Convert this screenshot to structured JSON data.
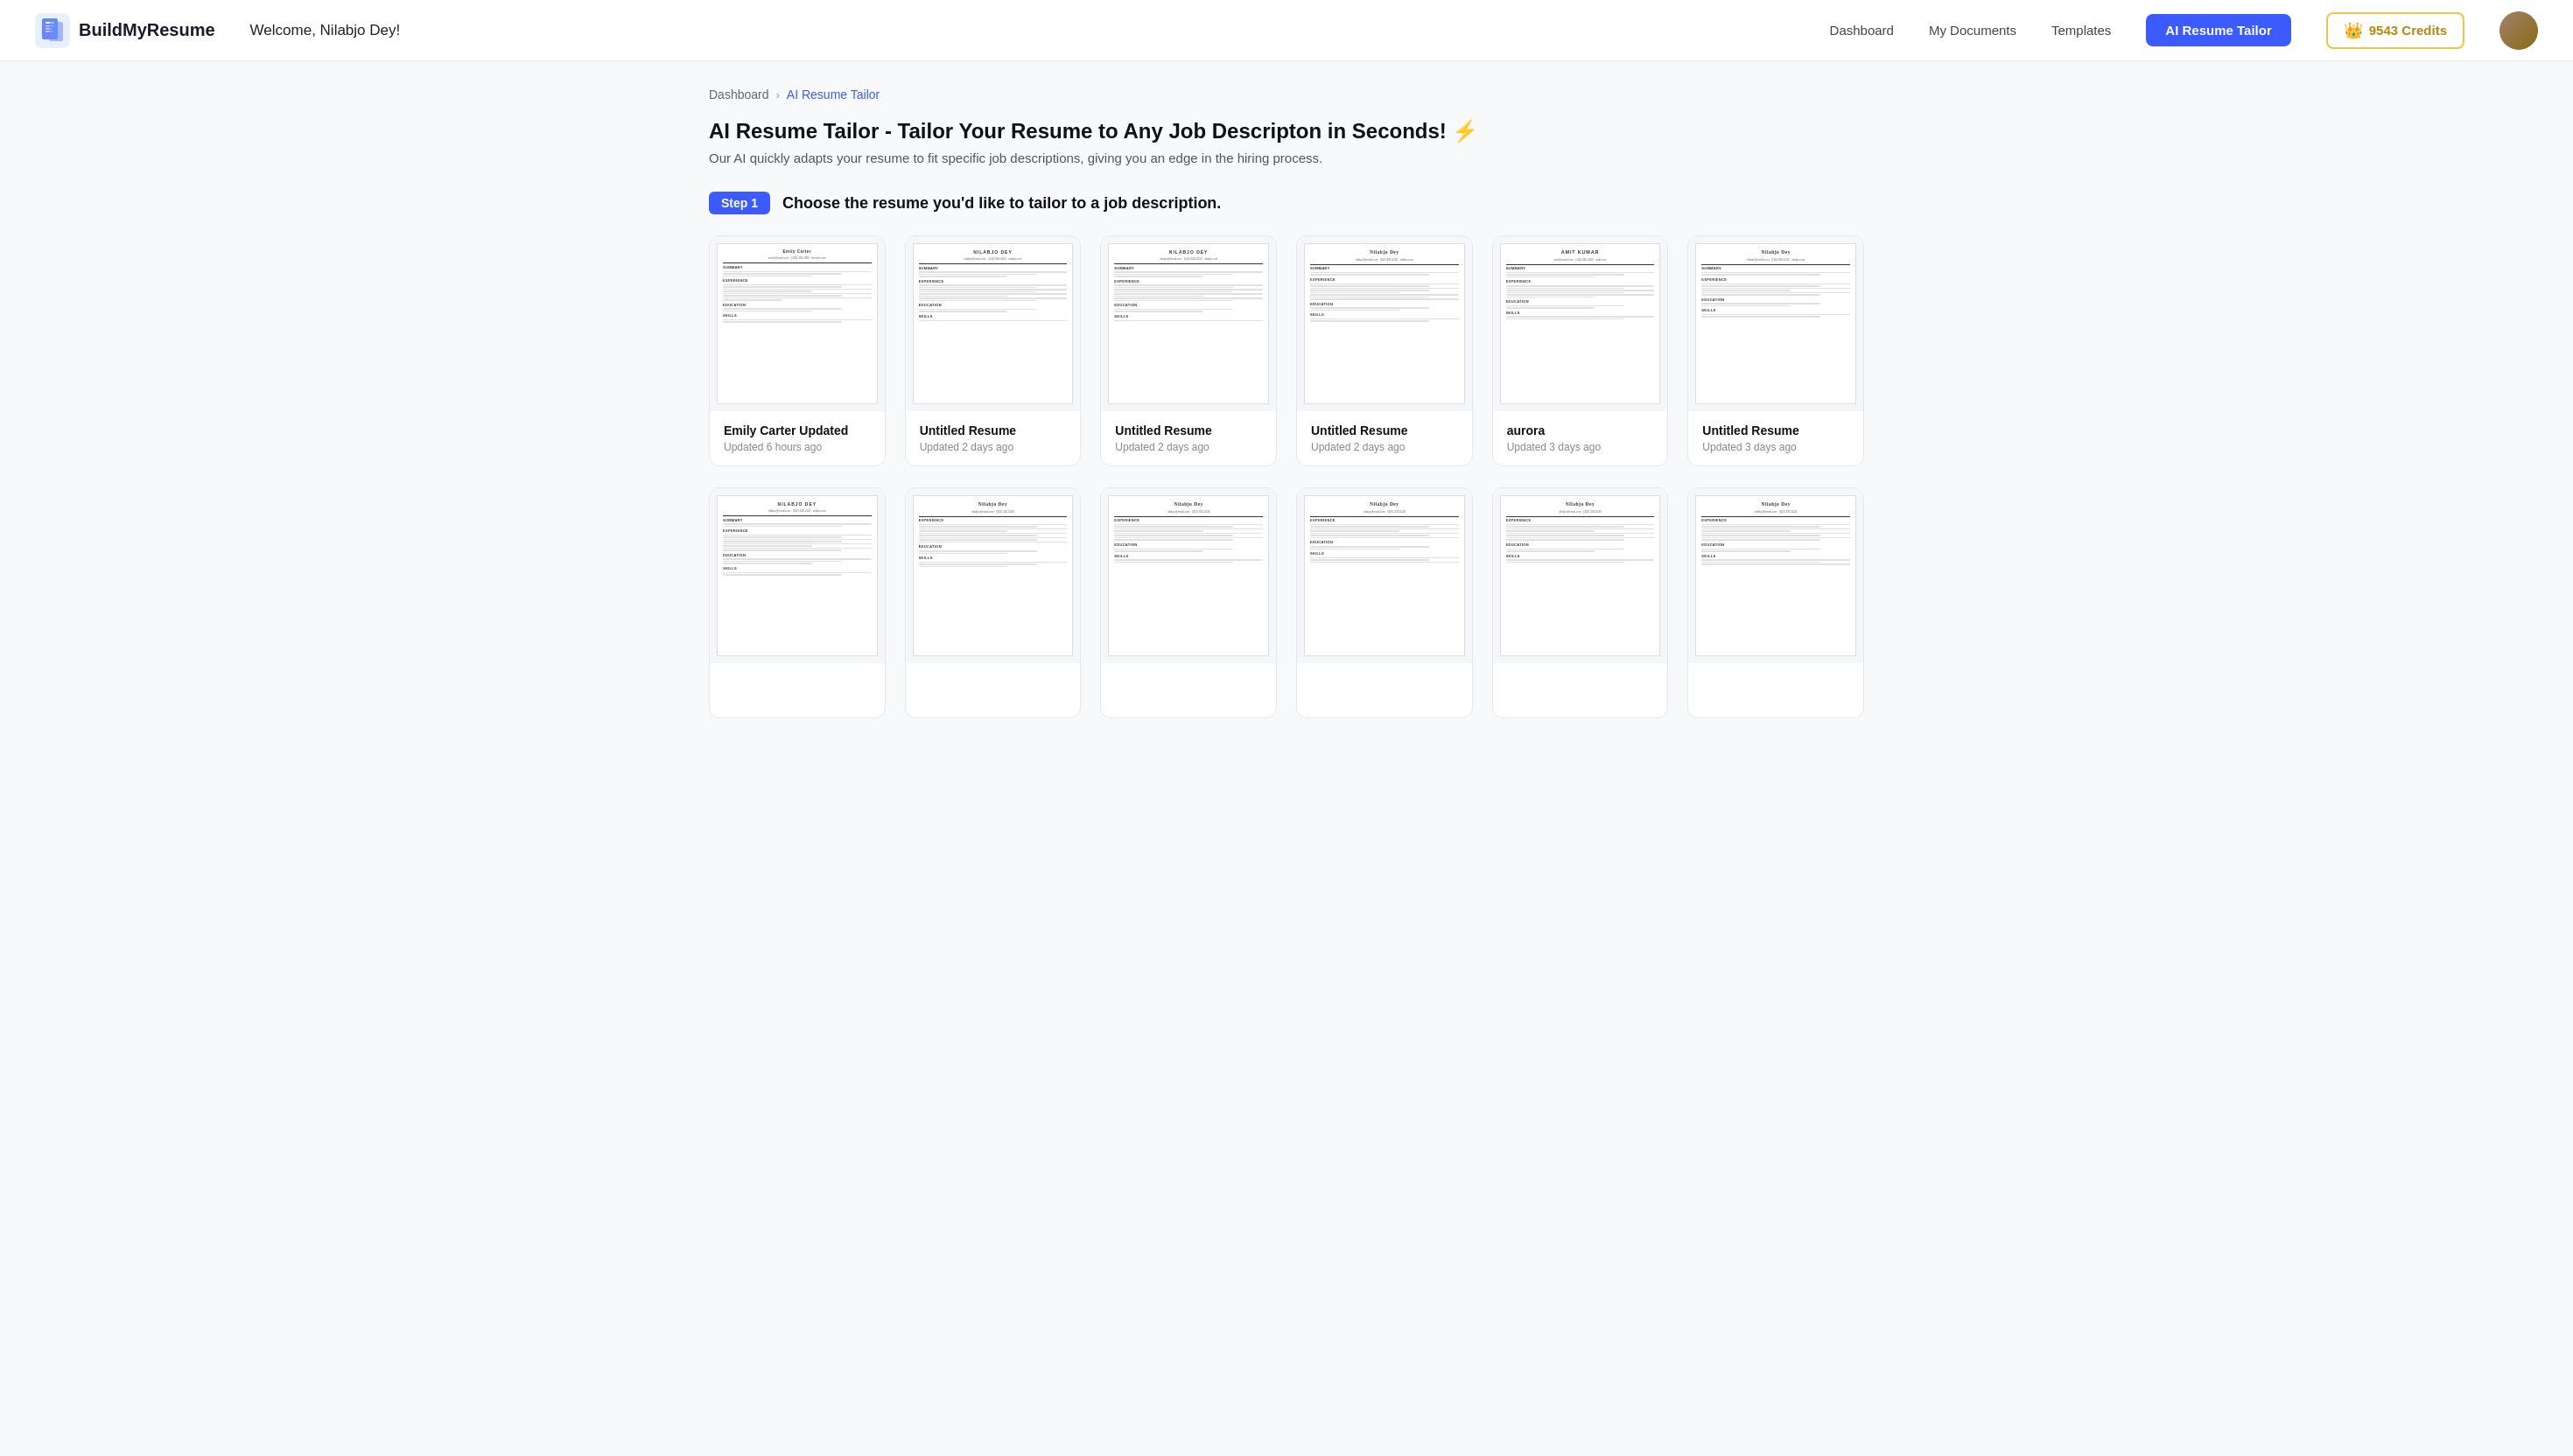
{
  "navbar": {
    "logo_text": "BuildMyResume",
    "welcome_text": "Welcome, Nilabjo Dey!",
    "links": [
      {
        "id": "dashboard",
        "label": "Dashboard"
      },
      {
        "id": "my-documents",
        "label": "My Documents"
      },
      {
        "id": "templates",
        "label": "Templates"
      }
    ],
    "ai_button_label": "AI Resume Tailor",
    "credits_icon": "👑",
    "credits_label": "9543 Credits"
  },
  "breadcrumb": {
    "items": [
      {
        "id": "dashboard",
        "label": "Dashboard",
        "active": false
      },
      {
        "id": "ai-resume-tailor",
        "label": "AI Resume Tailor",
        "active": true
      }
    ]
  },
  "page": {
    "title": "AI Resume Tailor - Tailor Your Resume to Any Job Descripton in Seconds! ⚡",
    "subtitle": "Our AI quickly adapts your resume to fit specific job descriptions, giving you an edge in the hiring process.",
    "step1_badge": "Step 1",
    "step1_text": "Choose the resume you'd like to tailor to a job description."
  },
  "resume_rows": [
    {
      "id": "row1",
      "cards": [
        {
          "id": "card1",
          "name": "Emily Carter Updated",
          "updated": "Updated 6 hours ago",
          "doc_name": "Emily Carter",
          "style": "emily"
        },
        {
          "id": "card2",
          "name": "Untitled Resume",
          "updated": "Updated 2 days ago",
          "doc_name": "NILABJO DEY",
          "style": "nilabjo"
        },
        {
          "id": "card3",
          "name": "Untitled Resume",
          "updated": "Updated 2 days ago",
          "doc_name": "NILABJO DEY",
          "style": "nilabjo"
        },
        {
          "id": "card4",
          "name": "Untitled Resume",
          "updated": "Updated 2 days ago",
          "doc_name": "Nilabjo Dey",
          "style": "nilabjo-serif"
        },
        {
          "id": "card5",
          "name": "aurora",
          "updated": "Updated 3 days ago",
          "doc_name": "AMIT KUMAR",
          "style": "amit"
        },
        {
          "id": "card6",
          "name": "Untitled Resume",
          "updated": "Updated 3 days ago",
          "doc_name": "Nilabjo Dey",
          "style": "nilabjo-serif"
        }
      ]
    },
    {
      "id": "row2",
      "cards": [
        {
          "id": "card7",
          "name": "",
          "updated": "",
          "doc_name": "NILABJO DEY",
          "style": "nilabjo"
        },
        {
          "id": "card8",
          "name": "",
          "updated": "",
          "doc_name": "Nilabjo Dey",
          "style": "nilabjo-serif"
        },
        {
          "id": "card9",
          "name": "",
          "updated": "",
          "doc_name": "Nilabjo Dey",
          "style": "nilabjo-serif"
        },
        {
          "id": "card10",
          "name": "",
          "updated": "",
          "doc_name": "Nilabjo Dey",
          "style": "nilabjo-serif"
        },
        {
          "id": "card11",
          "name": "",
          "updated": "",
          "doc_name": "Nilabjo Dey",
          "style": "nilabjo-serif"
        },
        {
          "id": "card12",
          "name": "",
          "updated": "",
          "doc_name": "Nilabjo Dey",
          "style": "nilabjo-serif"
        }
      ]
    }
  ]
}
